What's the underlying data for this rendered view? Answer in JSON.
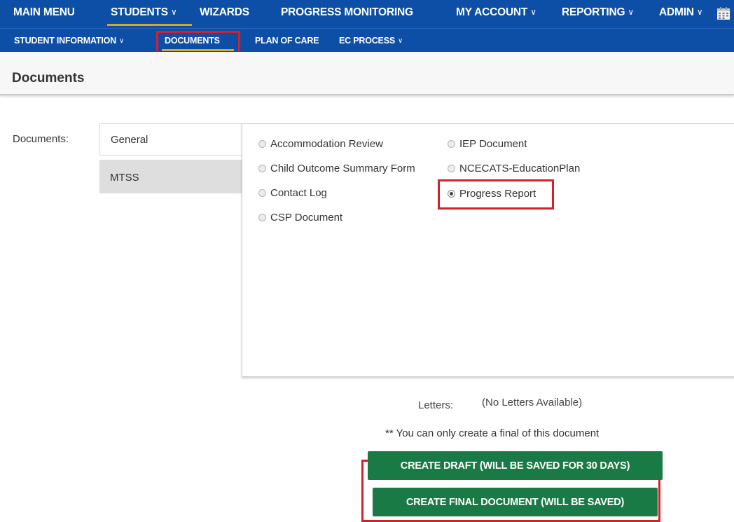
{
  "nav": {
    "main_menu": "MAIN MENU",
    "students": "STUDENTS",
    "wizards": "WIZARDS",
    "progress_monitoring": "PROGRESS MONITORING",
    "my_account": "MY ACCOUNT",
    "reporting": "REPORTING",
    "admin": "ADMIN",
    "chevron": "∨"
  },
  "subnav": {
    "student_information": "STUDENT INFORMATION",
    "documents": "DOCUMENTS",
    "plan_of_care": "PLAN OF CARE",
    "ec_process": "EC PROCESS"
  },
  "page": {
    "title": "Documents"
  },
  "documents": {
    "label": "Documents:",
    "tabs": [
      {
        "label": "General",
        "active": true
      },
      {
        "label": "MTSS",
        "active": false
      }
    ],
    "options": [
      {
        "label": "Accommodation Review",
        "checked": false
      },
      {
        "label": "Child Outcome Summary Form",
        "checked": false
      },
      {
        "label": "Contact Log",
        "checked": false
      },
      {
        "label": "CSP Document",
        "checked": false
      },
      {
        "label": "IEP Document",
        "checked": false
      },
      {
        "label": "NCECATS-EducationPlan",
        "checked": false
      },
      {
        "label": "Progress Report",
        "checked": true
      }
    ]
  },
  "letters": {
    "label": "Letters:",
    "value": "(No Letters Available)"
  },
  "note": "** You can only create a final of this document",
  "buttons": {
    "create_draft": "CREATE DRAFT (WILL BE SAVED FOR 30 DAYS)",
    "create_final": "CREATE FINAL DOCUMENT (WILL BE SAVED)"
  },
  "colors": {
    "nav_blue": "#0d4fa6",
    "accent_gold": "#d4a62a",
    "highlight_red": "#d2202c",
    "button_green": "#1a7a45"
  },
  "icons": {
    "calendar": "calendar-icon"
  }
}
